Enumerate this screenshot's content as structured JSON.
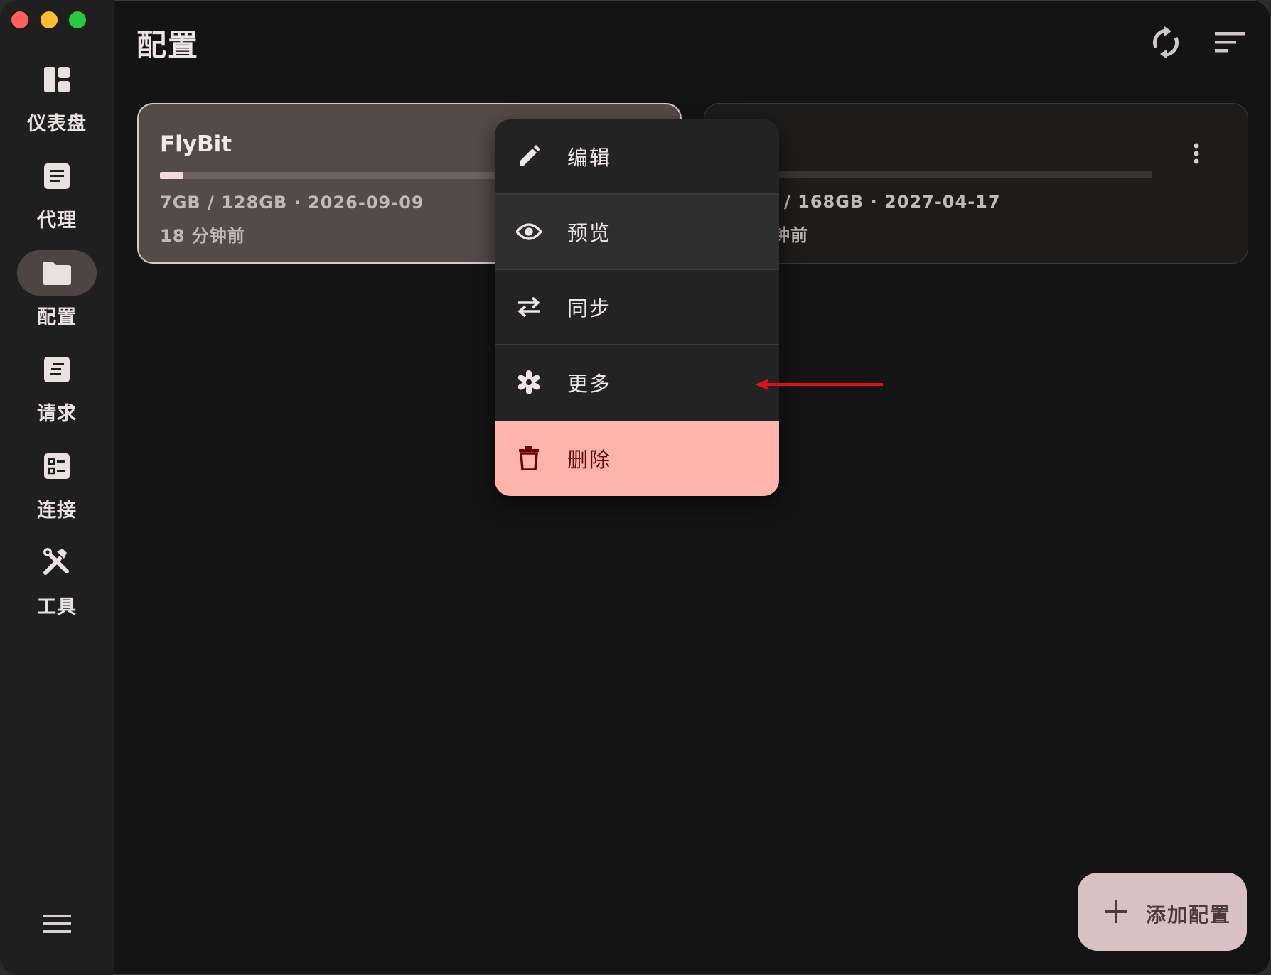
{
  "window": {
    "controls": [
      "close",
      "minimize",
      "zoom"
    ]
  },
  "sidebar": {
    "items": [
      {
        "label": "仪表盘",
        "icon": "dashboard-icon",
        "active": false
      },
      {
        "label": "代理",
        "icon": "proxy-list-icon",
        "active": false
      },
      {
        "label": "配置",
        "icon": "folder-icon",
        "active": true
      },
      {
        "label": "请求",
        "icon": "requests-icon",
        "active": false
      },
      {
        "label": "连接",
        "icon": "connections-icon",
        "active": false
      },
      {
        "label": "工具",
        "icon": "tools-icon",
        "active": false
      }
    ],
    "menu_icon": "hamburger-menu-icon"
  },
  "header": {
    "title": "配置",
    "actions": [
      "sync-icon",
      "sort-icon"
    ]
  },
  "profiles": [
    {
      "name": "FlyBit",
      "usage": "7GB / 128GB · 2026-09-09",
      "updated": "18 分钟前",
      "usage_fraction": 0.055,
      "selected": true
    },
    {
      "name": "",
      "usage": "/ 168GB · 2027-04-17",
      "updated": "钟前",
      "usage_fraction": 0,
      "selected": false
    }
  ],
  "context_menu": {
    "items": [
      {
        "label": "编辑",
        "icon": "edit-pencil-icon"
      },
      {
        "label": "预览",
        "icon": "eye-icon"
      },
      {
        "label": "同步",
        "icon": "swap-arrows-icon"
      },
      {
        "label": "更多",
        "icon": "more-asterisk-icon"
      },
      {
        "label": "删除",
        "icon": "trash-icon",
        "danger": true
      }
    ]
  },
  "fab": {
    "label": "添加配置",
    "icon": "plus-icon"
  },
  "colors": {
    "background": "#141414",
    "sidebar": "#1f1f1f",
    "selected_card": "#554a4a",
    "danger_bg": "#ffb4ab",
    "danger_text": "#690005",
    "fab_bg": "#d8c1c4",
    "annotation_arrow": "#e0101a"
  }
}
